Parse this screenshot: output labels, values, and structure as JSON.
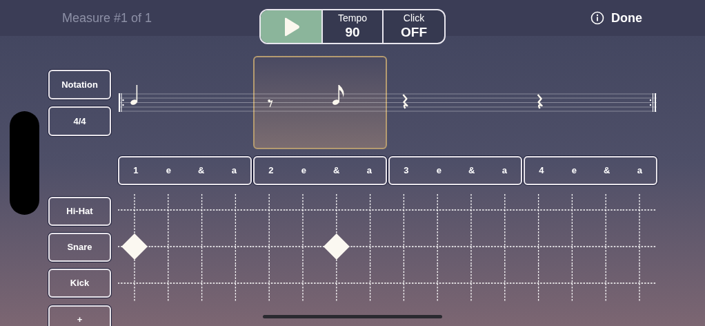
{
  "header": {
    "measure_label": "Measure #1 of 1",
    "done": "Done"
  },
  "transport": {
    "playing": false,
    "tempo_label": "Tempo",
    "tempo_value": "90",
    "click_label": "Click",
    "click_value": "OFF"
  },
  "side_buttons": [
    "Notation",
    "4/4"
  ],
  "staff": [
    {
      "kind": "quarter_note"
    },
    {
      "kind": "eighth_rest"
    },
    {
      "kind": "eighth_note"
    },
    {
      "kind": "quarter_rest"
    },
    {
      "kind": "quarter_rest"
    }
  ],
  "beats": [
    {
      "counts": [
        "1",
        "e",
        "&",
        "a"
      ],
      "selected": false
    },
    {
      "counts": [
        "2",
        "e",
        "&",
        "a"
      ],
      "selected": true
    },
    {
      "counts": [
        "3",
        "e",
        "&",
        "a"
      ],
      "selected": false
    },
    {
      "counts": [
        "4",
        "e",
        "&",
        "a"
      ],
      "selected": false
    }
  ],
  "tracks": [
    {
      "name": "Hi-Hat",
      "steps": [
        false,
        false,
        false,
        false,
        false,
        false,
        false,
        false,
        false,
        false,
        false,
        false,
        false,
        false,
        false,
        false
      ]
    },
    {
      "name": "Snare",
      "steps": [
        true,
        false,
        false,
        false,
        false,
        false,
        true,
        false,
        false,
        false,
        false,
        false,
        false,
        false,
        false,
        false
      ]
    },
    {
      "name": "Kick",
      "steps": [
        false,
        false,
        false,
        false,
        false,
        false,
        false,
        false,
        false,
        false,
        false,
        false,
        false,
        false,
        false,
        false
      ]
    }
  ],
  "add_track": "+"
}
